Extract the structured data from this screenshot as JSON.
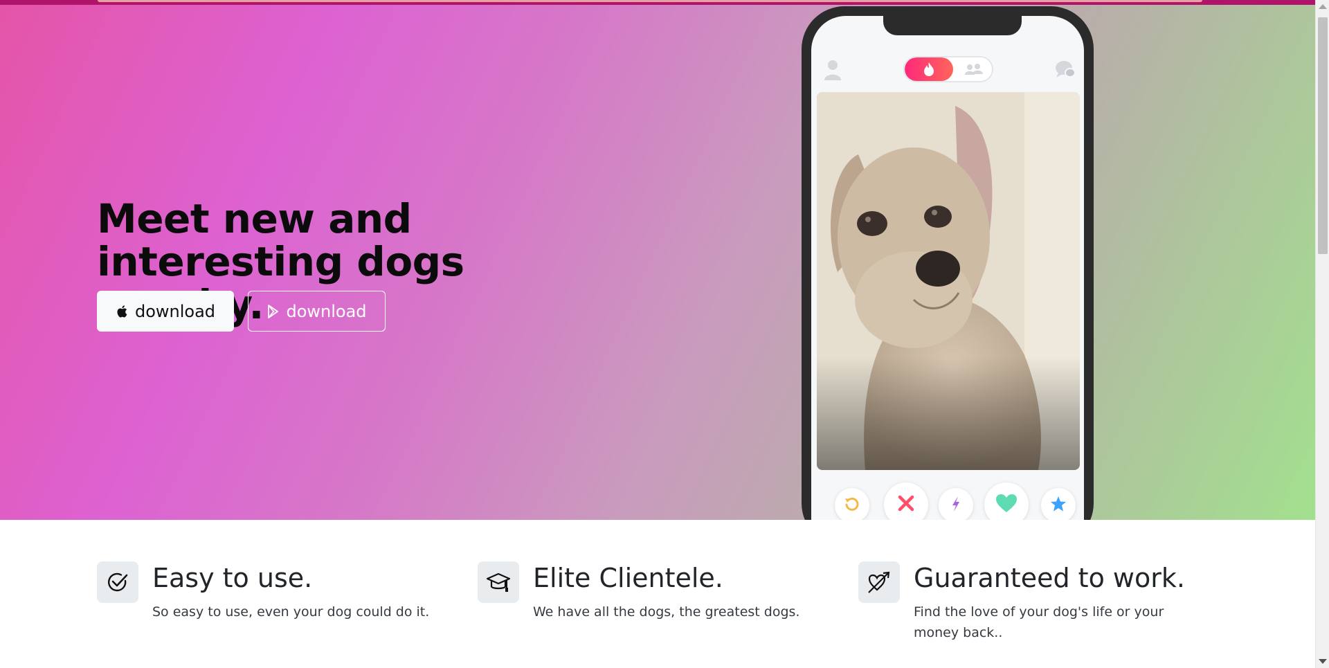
{
  "hero": {
    "headline": "Meet new and interesting dogs nearby.",
    "apple_button_label": "download",
    "play_button_label": "download",
    "gradient_colors": [
      "#e455a8",
      "#dd62d2",
      "#c99bbd",
      "#a2e08e"
    ]
  },
  "phone": {
    "icons": {
      "profile": "profile-icon",
      "flame": "flame-icon",
      "group": "group-icon",
      "chat": "chat-icon",
      "rewind": "rewind-icon",
      "nope": "x-icon",
      "boost": "lightning-icon",
      "like": "heart-icon",
      "super_like": "star-icon"
    },
    "action_colors": {
      "rewind": "#f5b748",
      "nope": "#fd5068",
      "boost": "#a963e1",
      "like": "#5edbb3",
      "super_like": "#3ca4ff"
    },
    "photo": "dog-photo"
  },
  "features": [
    {
      "icon": "check-circle-icon",
      "title": "Easy to use.",
      "text": "So easy to use, even your dog could do it."
    },
    {
      "icon": "graduation-cap-icon",
      "title": "Elite Clientele.",
      "text": "We have all the dogs, the greatest dogs."
    },
    {
      "icon": "heart-arrow-icon",
      "title": "Guaranteed to work.",
      "text": "Find the love of your dog's life or your money back.."
    }
  ]
}
